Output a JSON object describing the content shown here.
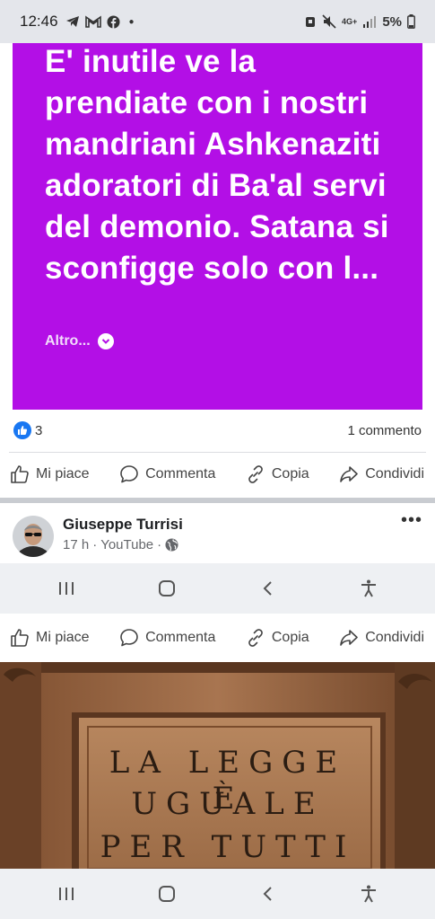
{
  "status_bar": {
    "time": "12:46",
    "battery": "5%",
    "network": "4G+"
  },
  "post1": {
    "text": "E' inutile ve la prendiate con i nostri mandriani Ashkenaziti adoratori di Ba'al servi del demonio. Satana si sconfigge solo con l...",
    "more_label": "Altro...",
    "background_color": "#b30fe6",
    "reaction_count": "3",
    "comment_count": "1 commento"
  },
  "actions": {
    "like": "Mi piace",
    "comment": "Commenta",
    "copy": "Copia",
    "share": "Condividi"
  },
  "post2": {
    "author": "Giuseppe Turrisi",
    "time": "17 h",
    "source": "YouTube",
    "plaque_lines": [
      "LA LEGGE È",
      "UGUALE",
      "PER TUTTI"
    ]
  },
  "colors": {
    "facebook_blue": "#1877f2",
    "nav_bg": "#eef0f3"
  }
}
